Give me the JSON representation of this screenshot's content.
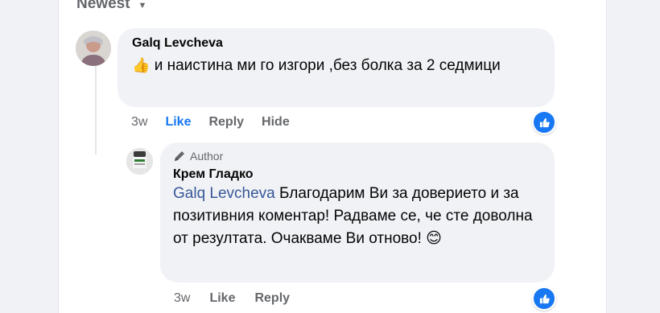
{
  "sort": {
    "label": "Newest"
  },
  "comments": [
    {
      "author": "Galq Levcheva",
      "emoji": "👍",
      "text": "и наистина ми го изгори ,без болка за 2 седмици",
      "time": "3w",
      "actions": {
        "like": "Like",
        "reply": "Reply",
        "hide": "Hide"
      },
      "liked": true
    }
  ],
  "reply": {
    "badge": "Author",
    "author": "Крем Гладко",
    "mention": "Galq Levcheva",
    "text": " Благодарим Ви за доверието и за позитивния коментар! Радваме се, че сте доволна от резултата. Очакваме Ви отново! ",
    "emoji": "😊",
    "time": "3w",
    "actions": {
      "like": "Like",
      "reply": "Reply"
    }
  },
  "colors": {
    "accent": "#1877f2",
    "bubble": "#f0f2f5",
    "muted": "#65676b"
  }
}
